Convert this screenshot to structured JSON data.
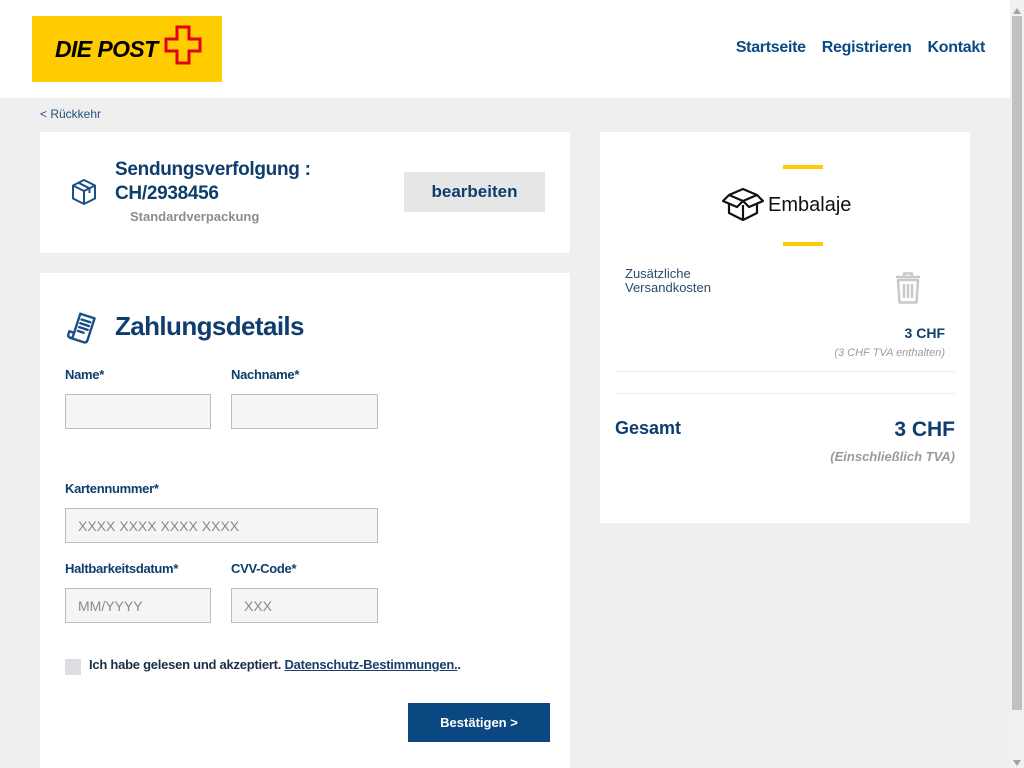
{
  "header": {
    "logo": {
      "text": "DIE POST",
      "icon": "swiss-cross-icon"
    },
    "nav": [
      {
        "label": "Startseite"
      },
      {
        "label": "Registrieren"
      },
      {
        "label": "Kontakt"
      }
    ]
  },
  "back_link": {
    "label": "< Rückkehr"
  },
  "shipment": {
    "icon": "package-icon",
    "title": "Sendungsverfolgung :",
    "tracking_number": "CH/2938456",
    "package_type": "Standardverpackung",
    "edit_button": "bearbeiten"
  },
  "payment": {
    "icon": "receipt-icon",
    "title": "Zahlungsdetails",
    "fields": {
      "name": {
        "label": "Name*",
        "value": ""
      },
      "surname": {
        "label": "Nachname*",
        "value": ""
      },
      "card_number": {
        "label": "Kartennummer*",
        "value": "",
        "placeholder": "XXXX XXXX XXXX XXXX"
      },
      "expiry": {
        "label": "Haltbarkeitsdatum*",
        "value": "",
        "placeholder": "MM/YYYY"
      },
      "cvv": {
        "label": "CVV-Code*",
        "value": "",
        "placeholder": "XXX"
      }
    },
    "terms": {
      "checked": false,
      "text": "Ich habe gelesen und akzeptiert.",
      "link": "Datenschutz-Bestimmungen.",
      "suffix": "."
    },
    "submit_button": "Bestätigen >"
  },
  "summary": {
    "product_icon": "open-box-icon",
    "product_name": "Embalaje",
    "item_label": "Zusätzliche Versandkosten",
    "item_delete_icon": "trash-icon",
    "item_price": "3 CHF",
    "item_tax_note": "(3 CHF TVA enthalten)",
    "total_label": "Gesamt",
    "total_price": "3 CHF",
    "total_tax_note": "(Einschließlich TVA)"
  },
  "colors": {
    "primary_text": "#0e3d6e",
    "nav_link": "#0b4a84",
    "brand_yellow": "#ffcc00",
    "brand_red": "#e2001a",
    "submit_button": "#0b4780",
    "page_background": "#efefef"
  }
}
